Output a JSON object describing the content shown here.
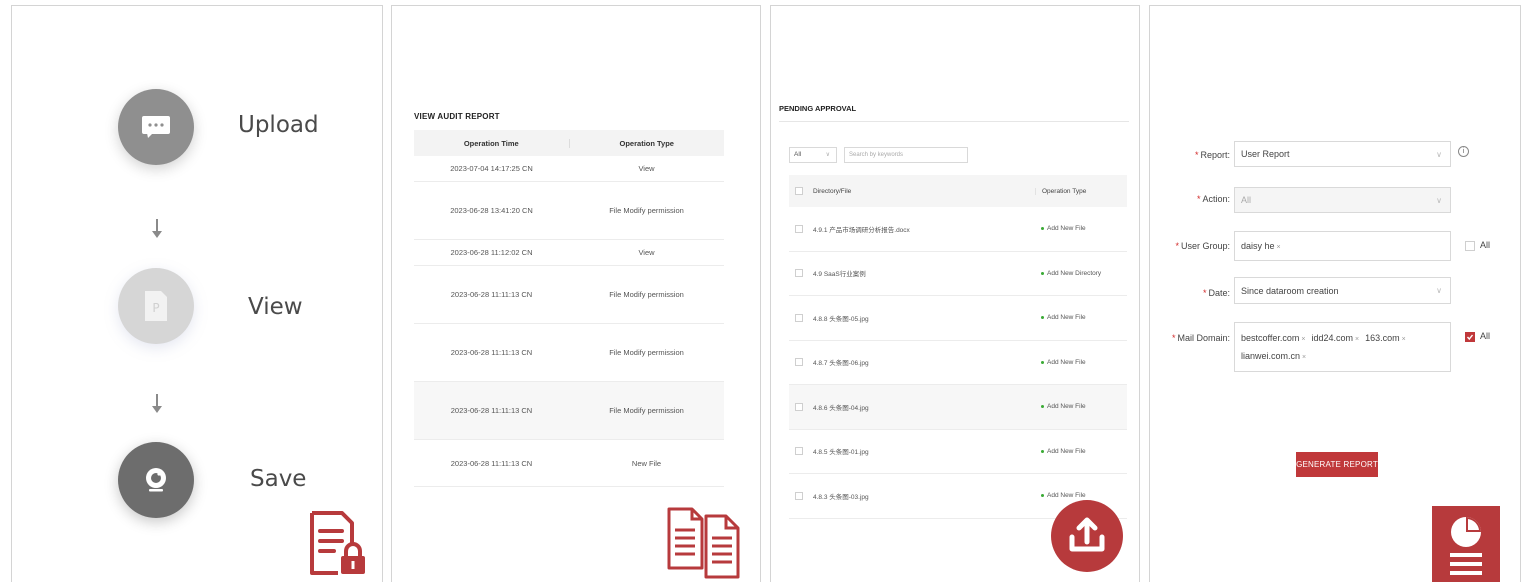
{
  "workflow": {
    "steps": [
      {
        "label": "Upload",
        "icon": "chat-bubble-icon"
      },
      {
        "label": "View",
        "icon": "document-p-icon"
      },
      {
        "label": "Save",
        "icon": "camera-icon"
      }
    ]
  },
  "audit": {
    "title": "VIEW AUDIT REPORT",
    "columns": [
      "Operation Time",
      "Operation Type"
    ],
    "rows": [
      {
        "time": "2023-07-04 14:17:25 CN",
        "type": "View"
      },
      {
        "time": "2023-06-28 13:41:20 CN",
        "type": "File Modify permission"
      },
      {
        "time": "2023-06-28 11:12:02 CN",
        "type": "View"
      },
      {
        "time": "2023-06-28 11:11:13 CN",
        "type": "File Modify permission"
      },
      {
        "time": "2023-06-28 11:11:13 CN",
        "type": "File Modify permission"
      },
      {
        "time": "2023-06-28 11:11:13 CN",
        "type": "File Modify permission"
      },
      {
        "time": "2023-06-28 11:11:13 CN",
        "type": "New File"
      }
    ]
  },
  "pending": {
    "title": "PENDING APPROVAL",
    "filter_value": "All",
    "search_placeholder": "Search by keywords",
    "columns": [
      "Directory/File",
      "Operation Type"
    ],
    "rows": [
      {
        "name": "4.9.1 产品市场调研分析报告.docx",
        "type": "Add New File"
      },
      {
        "name": "4.9 SaaS行业案例",
        "type": "Add New Directory"
      },
      {
        "name": "4.8.8 头条图-05.jpg",
        "type": "Add New File"
      },
      {
        "name": "4.8.7 头条图-06.jpg",
        "type": "Add New File"
      },
      {
        "name": "4.8.6 头条图-04.jpg",
        "type": "Add New File"
      },
      {
        "name": "4.8.5 头条图-01.jpg",
        "type": "Add New File"
      },
      {
        "name": "4.8.3 头条图-03.jpg",
        "type": "Add New File"
      }
    ]
  },
  "report_form": {
    "report_label": "Report:",
    "report_value": "User Report",
    "action_label": "Action:",
    "action_value": "All",
    "user_group_label": "User Group:",
    "user_group_tags": [
      "daisy he"
    ],
    "user_group_all": "All",
    "date_label": "Date:",
    "date_value": "Since dataroom creation",
    "mail_domain_label": "Mail Domain:",
    "mail_domain_tags": [
      "bestcoffer.com",
      "idd24.com",
      "163.com",
      "lianwei.com.cn"
    ],
    "mail_domain_all": "All",
    "generate_label": "GENERATE REPORT",
    "required_mark": "*",
    "remove_mark": "×",
    "info_mark": "i"
  },
  "colors": {
    "accent": "#c0383a",
    "status_dot": "#3aaa35",
    "upload_circle": "#8f8f8f",
    "view_circle": "#d6d6d6",
    "save_circle": "#6d6d6d"
  },
  "corner_icons": [
    "document-lock-icon",
    "documents-copy-icon",
    "upload-circle-icon",
    "report-pie-icon"
  ]
}
